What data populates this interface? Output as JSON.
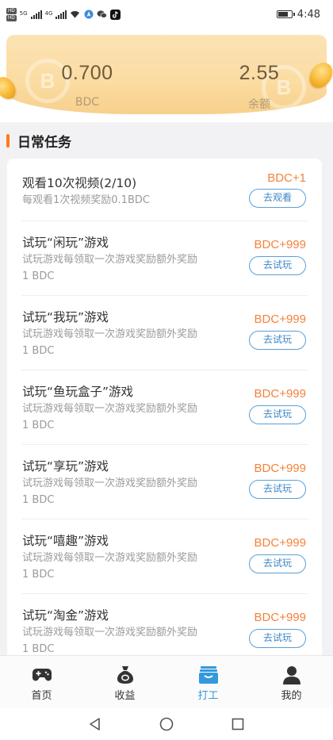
{
  "status_bar": {
    "hd_badges": [
      "HD",
      "HD"
    ],
    "network_types": [
      "5G",
      "4G"
    ],
    "time": "4:48",
    "battery_level": 0.8,
    "icons": [
      "wifi-icon",
      "location-icon",
      "wechat-icon",
      "tiktok-icon",
      "battery-icon"
    ]
  },
  "banner": {
    "left_value": "0.700",
    "left_label": "BDC",
    "right_value": "2.55",
    "right_label": "余额",
    "watermark_letter": "B"
  },
  "section": {
    "title": "日常任务"
  },
  "tasks": [
    {
      "title": "观看10次视频(2/10)",
      "desc": "每观看1次视频奖励0.1BDC",
      "reward": "BDC+1",
      "button": "去观看"
    },
    {
      "title": "试玩“闲玩”游戏",
      "desc": "试玩游戏每领取一次游戏奖励额外奖励 1 BDC",
      "reward": "BDC+999",
      "button": "去试玩"
    },
    {
      "title": "试玩“我玩”游戏",
      "desc": "试玩游戏每领取一次游戏奖励额外奖励 1 BDC",
      "reward": "BDC+999",
      "button": "去试玩"
    },
    {
      "title": "试玩“鱼玩盒子”游戏",
      "desc": "试玩游戏每领取一次游戏奖励额外奖励 1 BDC",
      "reward": "BDC+999",
      "button": "去试玩"
    },
    {
      "title": "试玩“享玩”游戏",
      "desc": "试玩游戏每领取一次游戏奖励额外奖励 1 BDC",
      "reward": "BDC+999",
      "button": "去试玩"
    },
    {
      "title": "试玩“嘻趣”游戏",
      "desc": "试玩游戏每领取一次游戏奖励额外奖励 1 BDC",
      "reward": "BDC+999",
      "button": "去试玩"
    },
    {
      "title": "试玩“淘金”游戏",
      "desc": "试玩游戏每领取一次游戏奖励额外奖励 1 BDC",
      "reward": "BDC+999",
      "button": "去试玩"
    }
  ],
  "bottom_nav": [
    {
      "label": "首页",
      "icon": "gamepad-icon",
      "active": false
    },
    {
      "label": "收益",
      "icon": "money-bag-icon",
      "active": false
    },
    {
      "label": "打工",
      "icon": "briefcase-icon",
      "active": true
    },
    {
      "label": "我的",
      "icon": "user-icon",
      "active": false
    }
  ],
  "colors": {
    "accent_orange": "#ff7a1a",
    "reward_orange": "#f5823a",
    "button_blue": "#3c86c6",
    "nav_active": "#3399dd",
    "banner_gold": "#fbdca2"
  }
}
